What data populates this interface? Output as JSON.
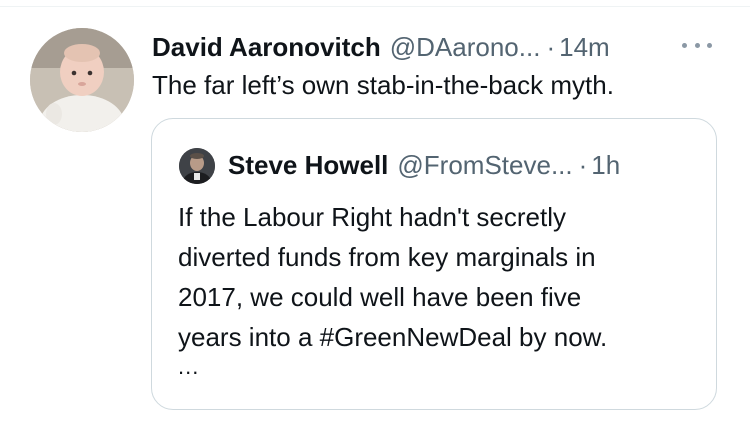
{
  "tweet": {
    "author": {
      "display_name": "David Aaronovitch",
      "handle": "@DAarono...",
      "avatar_icon": "baby-photo-avatar"
    },
    "separator": "·",
    "timestamp": "14m",
    "more_icon": "more-horizontal-icon",
    "text": "The far left’s own stab-in-the-back myth."
  },
  "quoted_tweet": {
    "author": {
      "display_name": "Steve Howell",
      "handle": "@FromSteve...",
      "avatar_icon": "person-photo-avatar"
    },
    "separator": "·",
    "timestamp": "1h",
    "text_lines": [
      "If the Labour Right hadn't secretly",
      "diverted funds from key marginals in",
      "2017, we could well have been five",
      "years into a #GreenNewDeal by now."
    ],
    "truncation": "..."
  },
  "colors": {
    "primary_text": "#0f1419",
    "secondary_text": "#536471",
    "card_border": "#cfd9de"
  }
}
